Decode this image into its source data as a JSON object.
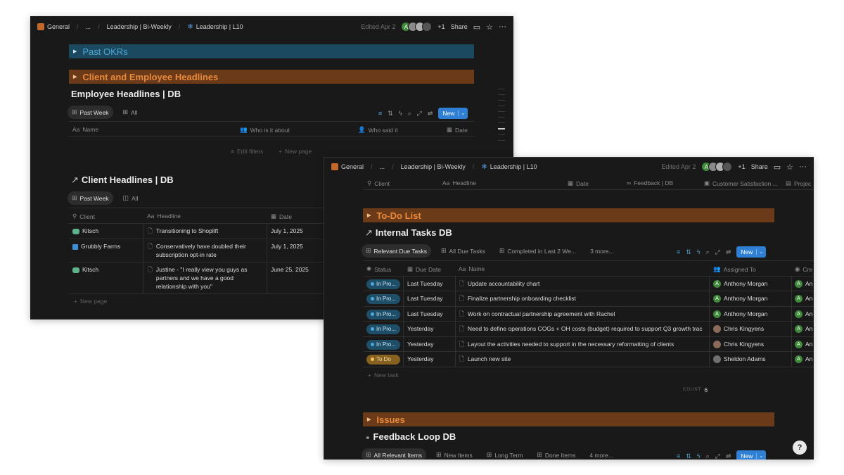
{
  "win1": {
    "topbar": {
      "breadcrumbs": [
        "General",
        "...",
        "Leadership | Bi-Weekly",
        "Leadership | L10"
      ],
      "edited": "Edited Apr 2",
      "avatar_initial": "A",
      "extra_count": "+1",
      "share": "Share"
    },
    "past_okrs": "Past OKRs",
    "client_employee_headlines": "Client and Employee Headlines",
    "employee_db": {
      "title": "Employee Headlines | DB",
      "tabs": [
        "Past Week",
        "All"
      ],
      "new_label": "New",
      "columns": [
        "Name",
        "Who is it about",
        "Who said it",
        "Date"
      ],
      "edit_filters": "Edit filters",
      "new_page": "New page"
    },
    "client_db": {
      "title": "Client Headlines | DB",
      "tabs": [
        "Past Week",
        "All"
      ],
      "columns": [
        "Client",
        "Headline",
        "Date"
      ],
      "rows": [
        {
          "client": "Kitsch",
          "headline": "Transitioning to Shoplift",
          "date": "July 1, 2025"
        },
        {
          "client": "Grubbly Farms",
          "headline": "Conservatively have doubled their subscription opt-in rate",
          "date": "July 1, 2025"
        },
        {
          "client": "Kitsch",
          "headline": "Justine - \"I really view you guys as partners and we have a good relationship with you\"",
          "date": "June 25, 2025"
        }
      ],
      "new_page": "New page"
    },
    "colors": {
      "client_kitsch": "#5fb38a",
      "client_grubbly": "#3a8fd8"
    }
  },
  "win2": {
    "topbar": {
      "breadcrumbs": [
        "General",
        "...",
        "Leadership | Bi-Weekly",
        "Leadership | L10"
      ],
      "edited": "Edited Apr 2",
      "avatar_initial": "A",
      "extra_count": "+1",
      "share": "Share"
    },
    "top_columns": [
      "Client",
      "Headline",
      "Date",
      "Feedback | DB",
      "Customer Satisfaction ...",
      "Projec"
    ],
    "todo_band": "To-Do List",
    "tasks_db": {
      "title": "Internal Tasks DB",
      "tabs": [
        "Relevant Due Tasks",
        "All Due Tasks",
        "Completed in Last 2 We...",
        "3 more..."
      ],
      "new_label": "New",
      "columns": [
        "Status",
        "Due Date",
        "Name",
        "Assigned To",
        "Cre"
      ],
      "rows": [
        {
          "status": "In Pro...",
          "status_kind": "progress",
          "due": "Last Tuesday",
          "name": "Update accountability chart",
          "assignee": "Anthony Morgan",
          "assignee_kind": "a",
          "creator": "An"
        },
        {
          "status": "In Pro...",
          "status_kind": "progress",
          "due": "Last Tuesday",
          "name": "Finalize partnership onboarding checklist",
          "assignee": "Anthony Morgan",
          "assignee_kind": "a",
          "creator": "An"
        },
        {
          "status": "In Pro...",
          "status_kind": "progress",
          "due": "Last Tuesday",
          "name": "Work on contractual partnership agreement with Rachel",
          "assignee": "Anthony Morgan",
          "assignee_kind": "a",
          "creator": "An"
        },
        {
          "status": "In Pro...",
          "status_kind": "progress",
          "due": "Yesterday",
          "name": "Need to define operations COGs + OH costs (budget) required to support Q3 growth trac",
          "assignee": "Chris Kingyens",
          "assignee_kind": "c",
          "creator": "An"
        },
        {
          "status": "In Pro...",
          "status_kind": "progress",
          "due": "Yesterday",
          "name": "Layout the activities needed to support in the necessary reformatting of clients",
          "assignee": "Chris Kingyens",
          "assignee_kind": "c",
          "creator": "An"
        },
        {
          "status": "To Do",
          "status_kind": "todo",
          "due": "Yesterday",
          "name": "Launch new site",
          "assignee": "Sheldon Adams",
          "assignee_kind": "s",
          "creator": "An"
        }
      ],
      "new_task": "New task",
      "count_label": "COUNT",
      "count_value": "6"
    },
    "issues_band": "Issues",
    "feedback_db": {
      "title": "Feedback Loop DB",
      "tabs": [
        "All Relevant Items",
        "New Items",
        "Long Term",
        "Done Items",
        "4 more..."
      ],
      "new_label": "New"
    },
    "help_glyph": "?"
  }
}
